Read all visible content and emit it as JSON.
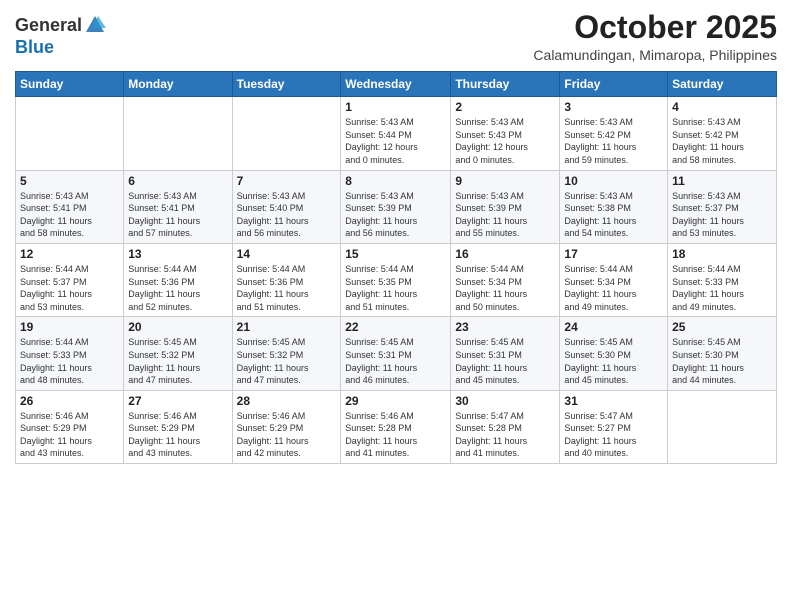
{
  "header": {
    "logo_line1": "General",
    "logo_line2": "Blue",
    "month": "October 2025",
    "location": "Calamundingan, Mimaropa, Philippines"
  },
  "days_of_week": [
    "Sunday",
    "Monday",
    "Tuesday",
    "Wednesday",
    "Thursday",
    "Friday",
    "Saturday"
  ],
  "weeks": [
    [
      {
        "day": "",
        "info": ""
      },
      {
        "day": "",
        "info": ""
      },
      {
        "day": "",
        "info": ""
      },
      {
        "day": "1",
        "info": "Sunrise: 5:43 AM\nSunset: 5:44 PM\nDaylight: 12 hours\nand 0 minutes."
      },
      {
        "day": "2",
        "info": "Sunrise: 5:43 AM\nSunset: 5:43 PM\nDaylight: 12 hours\nand 0 minutes."
      },
      {
        "day": "3",
        "info": "Sunrise: 5:43 AM\nSunset: 5:42 PM\nDaylight: 11 hours\nand 59 minutes."
      },
      {
        "day": "4",
        "info": "Sunrise: 5:43 AM\nSunset: 5:42 PM\nDaylight: 11 hours\nand 58 minutes."
      }
    ],
    [
      {
        "day": "5",
        "info": "Sunrise: 5:43 AM\nSunset: 5:41 PM\nDaylight: 11 hours\nand 58 minutes."
      },
      {
        "day": "6",
        "info": "Sunrise: 5:43 AM\nSunset: 5:41 PM\nDaylight: 11 hours\nand 57 minutes."
      },
      {
        "day": "7",
        "info": "Sunrise: 5:43 AM\nSunset: 5:40 PM\nDaylight: 11 hours\nand 56 minutes."
      },
      {
        "day": "8",
        "info": "Sunrise: 5:43 AM\nSunset: 5:39 PM\nDaylight: 11 hours\nand 56 minutes."
      },
      {
        "day": "9",
        "info": "Sunrise: 5:43 AM\nSunset: 5:39 PM\nDaylight: 11 hours\nand 55 minutes."
      },
      {
        "day": "10",
        "info": "Sunrise: 5:43 AM\nSunset: 5:38 PM\nDaylight: 11 hours\nand 54 minutes."
      },
      {
        "day": "11",
        "info": "Sunrise: 5:43 AM\nSunset: 5:37 PM\nDaylight: 11 hours\nand 53 minutes."
      }
    ],
    [
      {
        "day": "12",
        "info": "Sunrise: 5:44 AM\nSunset: 5:37 PM\nDaylight: 11 hours\nand 53 minutes."
      },
      {
        "day": "13",
        "info": "Sunrise: 5:44 AM\nSunset: 5:36 PM\nDaylight: 11 hours\nand 52 minutes."
      },
      {
        "day": "14",
        "info": "Sunrise: 5:44 AM\nSunset: 5:36 PM\nDaylight: 11 hours\nand 51 minutes."
      },
      {
        "day": "15",
        "info": "Sunrise: 5:44 AM\nSunset: 5:35 PM\nDaylight: 11 hours\nand 51 minutes."
      },
      {
        "day": "16",
        "info": "Sunrise: 5:44 AM\nSunset: 5:34 PM\nDaylight: 11 hours\nand 50 minutes."
      },
      {
        "day": "17",
        "info": "Sunrise: 5:44 AM\nSunset: 5:34 PM\nDaylight: 11 hours\nand 49 minutes."
      },
      {
        "day": "18",
        "info": "Sunrise: 5:44 AM\nSunset: 5:33 PM\nDaylight: 11 hours\nand 49 minutes."
      }
    ],
    [
      {
        "day": "19",
        "info": "Sunrise: 5:44 AM\nSunset: 5:33 PM\nDaylight: 11 hours\nand 48 minutes."
      },
      {
        "day": "20",
        "info": "Sunrise: 5:45 AM\nSunset: 5:32 PM\nDaylight: 11 hours\nand 47 minutes."
      },
      {
        "day": "21",
        "info": "Sunrise: 5:45 AM\nSunset: 5:32 PM\nDaylight: 11 hours\nand 47 minutes."
      },
      {
        "day": "22",
        "info": "Sunrise: 5:45 AM\nSunset: 5:31 PM\nDaylight: 11 hours\nand 46 minutes."
      },
      {
        "day": "23",
        "info": "Sunrise: 5:45 AM\nSunset: 5:31 PM\nDaylight: 11 hours\nand 45 minutes."
      },
      {
        "day": "24",
        "info": "Sunrise: 5:45 AM\nSunset: 5:30 PM\nDaylight: 11 hours\nand 45 minutes."
      },
      {
        "day": "25",
        "info": "Sunrise: 5:45 AM\nSunset: 5:30 PM\nDaylight: 11 hours\nand 44 minutes."
      }
    ],
    [
      {
        "day": "26",
        "info": "Sunrise: 5:46 AM\nSunset: 5:29 PM\nDaylight: 11 hours\nand 43 minutes."
      },
      {
        "day": "27",
        "info": "Sunrise: 5:46 AM\nSunset: 5:29 PM\nDaylight: 11 hours\nand 43 minutes."
      },
      {
        "day": "28",
        "info": "Sunrise: 5:46 AM\nSunset: 5:29 PM\nDaylight: 11 hours\nand 42 minutes."
      },
      {
        "day": "29",
        "info": "Sunrise: 5:46 AM\nSunset: 5:28 PM\nDaylight: 11 hours\nand 41 minutes."
      },
      {
        "day": "30",
        "info": "Sunrise: 5:47 AM\nSunset: 5:28 PM\nDaylight: 11 hours\nand 41 minutes."
      },
      {
        "day": "31",
        "info": "Sunrise: 5:47 AM\nSunset: 5:27 PM\nDaylight: 11 hours\nand 40 minutes."
      },
      {
        "day": "",
        "info": ""
      }
    ]
  ]
}
